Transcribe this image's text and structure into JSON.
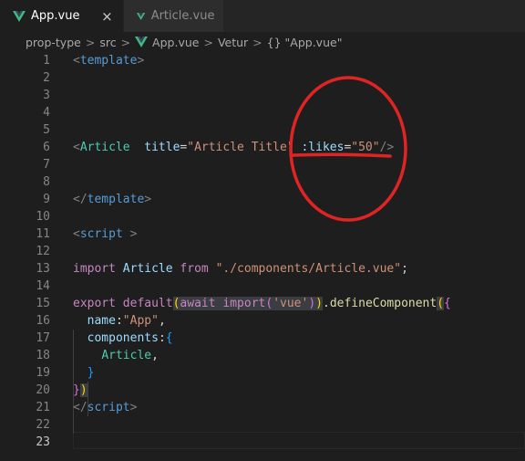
{
  "tabs": [
    {
      "label": "App.vue",
      "active": true,
      "close": "×"
    },
    {
      "label": "Article.vue",
      "active": false
    }
  ],
  "breadcrumb": {
    "items": [
      "prop-type",
      "src",
      "App.vue",
      "Vetur",
      "{} \"App.vue\""
    ],
    "separator": ">"
  },
  "editor": {
    "line_numbers": [
      "1",
      "2",
      "3",
      "4",
      "5",
      "6",
      "7",
      "8",
      "9",
      "10",
      "11",
      "12",
      "13",
      "14",
      "15",
      "16",
      "17",
      "18",
      "19",
      "20",
      "21",
      "22",
      "23"
    ],
    "current_line": "23",
    "tokens": {
      "l1_open": "<",
      "l1_tag": "template",
      "l1_close": ">",
      "l6_open": "<",
      "l6_comp": "Article",
      "l6_attr1": "title",
      "l6_eq1": "=",
      "l6_val1": "\"Article Title\"",
      "l6_attr2": ":likes",
      "l6_eq2": "=",
      "l6_val2": "\"50\"",
      "l6_close": "/>",
      "l9_open": "</",
      "l9_tag": "template",
      "l9_close": ">",
      "l11_open": "<",
      "l11_tag": "script",
      "l11_close": " >",
      "l13_import": "import",
      "l13_name": "Article",
      "l13_from": "from",
      "l13_path": "\"./components/Article.vue\"",
      "l13_semi": ";",
      "l15_export": "export",
      "l15_default": "default",
      "l15_paren_open": "(",
      "l15_await": "await",
      "l15_import": "import",
      "l15_paren2_open": "(",
      "l15_vue": "'vue'",
      "l15_paren2_close": ")",
      "l15_paren_close": ")",
      "l15_dot": ".",
      "l15_define": "defineComponent",
      "l15_paren3_open": "(",
      "l15_brace_open": "{",
      "l16_name": "name",
      "l16_colon": ":",
      "l16_val": "\"App\"",
      "l16_comma": ",",
      "l17_components": "components",
      "l17_colon": ":",
      "l17_brace": "{",
      "l18_article": "Article",
      "l18_comma": ",",
      "l19_brace": "}",
      "l20_brace": "}",
      "l20_paren": ")",
      "l21_open": "</",
      "l21_tag": "script",
      "l21_close": ">"
    }
  },
  "colors": {
    "annotation": "#e02424",
    "vue_green": "#41b883"
  }
}
